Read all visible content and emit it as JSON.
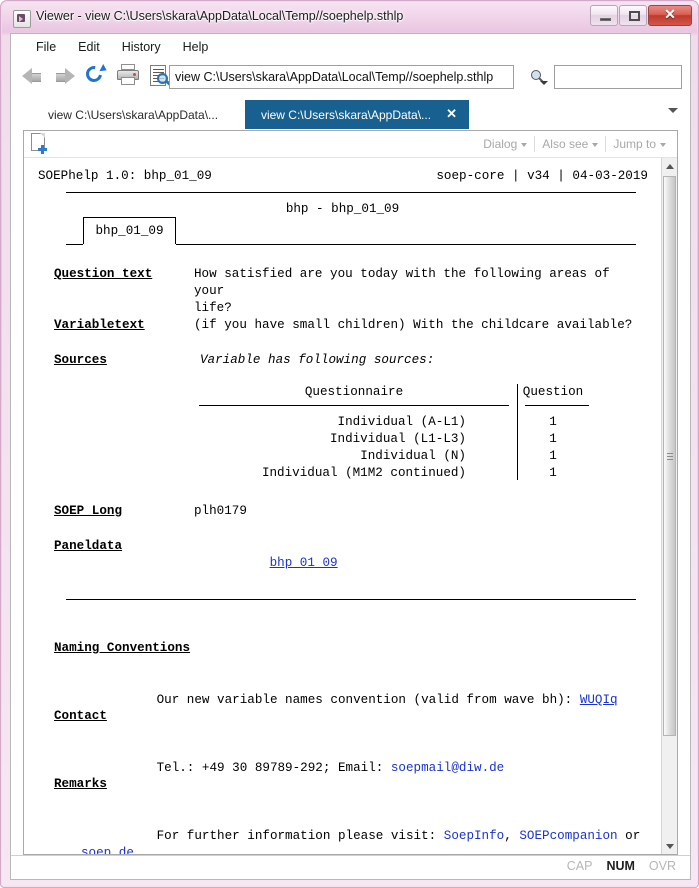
{
  "window": {
    "title": "Viewer - view C:\\Users\\skara\\AppData\\Local\\Temp//soephelp.sthlp",
    "icon": "viewer-icon",
    "controls": {
      "minimize": "minimize-icon",
      "maximize": "maximize-icon",
      "close": "✕"
    }
  },
  "menu": {
    "items": [
      {
        "label": "File"
      },
      {
        "label": "Edit"
      },
      {
        "label": "History"
      },
      {
        "label": "Help"
      }
    ]
  },
  "toolbar": {
    "back_icon": "back-arrow-icon",
    "forward_icon": "forward-arrow-icon",
    "refresh_icon": "refresh-icon",
    "print_icon": "print-icon",
    "find_icon": "document-search-icon",
    "address_value": "view C:\\Users\\skara\\AppData\\Local\\Temp//soephelp.sthlp",
    "address_placeholder": "",
    "search_icon": "search-dropdown-icon",
    "search_value": "",
    "search_placeholder": ""
  },
  "tabs": {
    "items": [
      {
        "label": "view C:\\Users\\skara\\AppData\\...",
        "active": false
      },
      {
        "label": "view C:\\Users\\skara\\AppData\\...",
        "active": true,
        "close": "✕"
      }
    ],
    "overflow_icon": "chevron-down-icon"
  },
  "viewer_toolbar": {
    "new_icon": "new-document-icon",
    "buttons": [
      {
        "label": "Dialog"
      },
      {
        "label": "Also see"
      },
      {
        "label": "Jump to"
      }
    ]
  },
  "document": {
    "header_left": "SOEPhelp 1.0: bhp_01_09",
    "header_right": "soep-core | v34 | 04-03-2019",
    "center_title": "bhp - bhp_01_09",
    "inner_tab": "bhp_01_09",
    "sections": [
      {
        "label": "Question text",
        "value": "How satisfied are you today with the following areas of your\nlife?"
      },
      {
        "label": "Variabletext",
        "value": "(if you have small children) With the childcare available?"
      },
      {
        "label": "Sources",
        "value": "Variable has following sources:"
      }
    ],
    "sources_table": {
      "columns": [
        "Questionnaire",
        "Question"
      ],
      "rows": [
        {
          "questionnaire": "Individual (A-L1)",
          "question": "1"
        },
        {
          "questionnaire": "Individual (L1-L3)",
          "question": "1"
        },
        {
          "questionnaire": "Individual (N)",
          "question": "1"
        },
        {
          "questionnaire": "Individual (M1M2 continued)",
          "question": "1"
        }
      ]
    },
    "soep_long": {
      "label": "SOEP Long",
      "value": "plh0179"
    },
    "paneldata": {
      "label": "Paneldata",
      "link": "bhp_01_09"
    },
    "naming": {
      "heading": "Naming Conventions",
      "text_before": "Our new variable names convention (valid from wave bh): ",
      "link": "WUQIq"
    },
    "contact": {
      "heading": "Contact",
      "text_before": "Tel.: +49 30 89789-292; Email: ",
      "email": "soepmail@diw.de"
    },
    "remarks": {
      "heading": "Remarks",
      "text_before": "For further information please visit: ",
      "link1": "SoepInfo",
      "sep1": ", ",
      "link2": "SOEPcompanion",
      "sep2": " or ",
      "link3": "soep.de"
    }
  },
  "statusbar": {
    "cap": "CAP",
    "num": "NUM",
    "ovr": "OVR"
  },
  "colors": {
    "active_tab": "#17608f",
    "link": "#1a32d4",
    "close_button": "#bd3b2c",
    "frame": "#e8c9e0"
  }
}
